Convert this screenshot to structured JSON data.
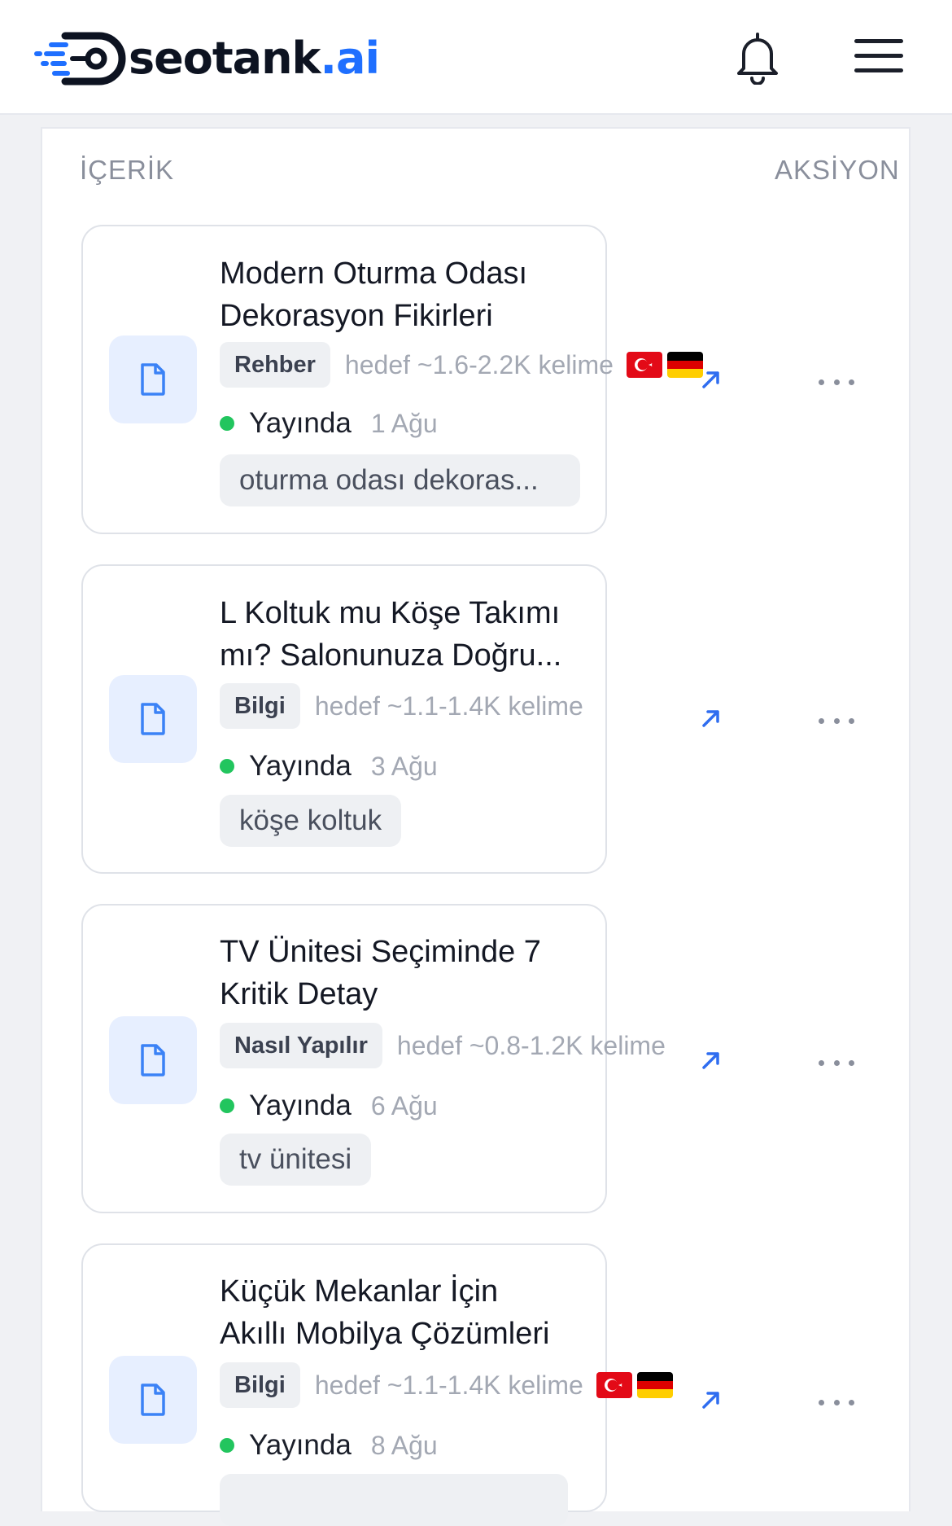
{
  "brand": {
    "name": "seotank",
    "tld": ".ai"
  },
  "header": {
    "notification_icon": "bell-icon",
    "menu_icon": "hamburger-icon"
  },
  "table": {
    "col_content": "İÇERİK",
    "col_action": "AKSİYON"
  },
  "items": [
    {
      "title_line1": "Modern Oturma Odası",
      "title_line2": "Dekorasyon Fikirleri",
      "type": "Rehber",
      "target": "hedef ~1.6-2.2K kelime",
      "languages": [
        "tr",
        "de"
      ],
      "status": "Yayında",
      "date": "1 Ağu",
      "keyword": "oturma odası dekoras..."
    },
    {
      "title_line1": "L Koltuk mu Köşe Takımı",
      "title_line2": "mı? Salonunuza Doğru...",
      "type": "Bilgi",
      "target": "hedef ~1.1-1.4K kelime",
      "languages": [],
      "status": "Yayında",
      "date": "3 Ağu",
      "keyword": "köşe koltuk"
    },
    {
      "title_line1": "TV Ünitesi Seçiminde 7",
      "title_line2": "Kritik Detay",
      "type": "Nasıl Yapılır",
      "target": "hedef ~0.8-1.2K kelime",
      "languages": [],
      "status": "Yayında",
      "date": "6 Ağu",
      "keyword": "tv ünitesi"
    },
    {
      "title_line1": "Küçük Mekanlar İçin",
      "title_line2": "Akıllı Mobilya Çözümleri",
      "type": "Bilgi",
      "target": "hedef ~1.1-1.4K kelime",
      "languages": [
        "tr",
        "de"
      ],
      "status": "Yayında",
      "date": "8 Ağu",
      "keyword": ""
    }
  ],
  "colors": {
    "accent": "#1f6fff",
    "status_live": "#22c55e",
    "doc_tile": "#e7efff"
  }
}
